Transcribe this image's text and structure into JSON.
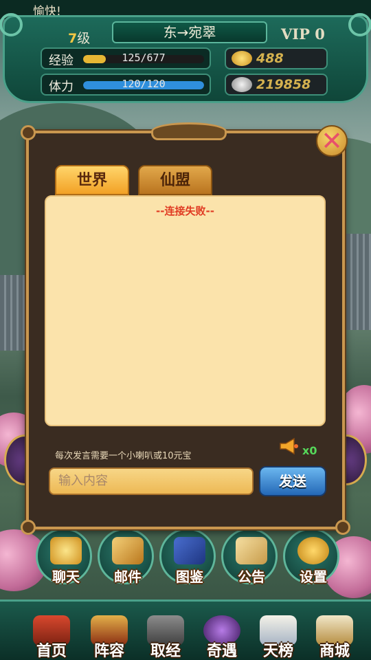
{
  "banner": {
    "text": "愉快!"
  },
  "player": {
    "level_num": "7",
    "level_unit": "级",
    "name": "东→宛翠",
    "vip": "VIP 0",
    "exp": {
      "label": "经验",
      "text": "125/677",
      "fraction": 0.185
    },
    "stamina": {
      "label": "体力",
      "text": "120/120",
      "fraction": 1.0
    },
    "gold": "488",
    "silver": "219858"
  },
  "chat": {
    "tabs": [
      {
        "label": "世界"
      },
      {
        "label": "仙盟"
      }
    ],
    "error": "--连接失败--",
    "hint": "每次发言需要一个小喇叭或10元宝",
    "horn_count": "x0",
    "input_placeholder": "输入内容",
    "send_label": "发送"
  },
  "menu": {
    "buttons": [
      {
        "label": "聊天",
        "icon": "chat-bubble-icon"
      },
      {
        "label": "邮件",
        "icon": "mail-icon"
      },
      {
        "label": "图鉴",
        "icon": "book-icon"
      },
      {
        "label": "公告",
        "icon": "scroll-icon"
      },
      {
        "label": "设置",
        "icon": "gear-icon"
      }
    ]
  },
  "nav": {
    "items": [
      {
        "label": "首页",
        "icon": "pagoda-icon"
      },
      {
        "label": "阵容",
        "icon": "warrior-icon"
      },
      {
        "label": "取经",
        "icon": "cave-door-icon"
      },
      {
        "label": "奇遇",
        "icon": "orb-icon"
      },
      {
        "label": "天榜",
        "icon": "scroll-list-icon"
      },
      {
        "label": "商城",
        "icon": "treasure-icon"
      }
    ]
  },
  "colors": {
    "exp_bar": "#e6b734",
    "stamina_bar": "#2f8fdc",
    "error": "#e03a22"
  }
}
